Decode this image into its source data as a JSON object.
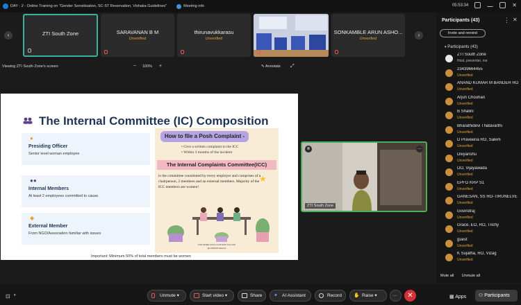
{
  "topbar": {
    "title": "DAY - 2 - Online Training on \"Gender Sensitisation, SC-ST Reservation, Vishaka Guidelines\"",
    "meeting_info": "Meeting info",
    "time": "05:53:34"
  },
  "filmstrip": [
    {
      "name": "ZTI South Zone",
      "status": ""
    },
    {
      "name": "SARAVANAN B M",
      "status": "Unverified"
    },
    {
      "name": "thirunavukkarasu",
      "status": "Unverified"
    },
    {
      "name": "",
      "status": ""
    },
    {
      "name": "SONKAMBLE ARUN ASHO...",
      "status": "Unverified"
    }
  ],
  "share_bar": {
    "viewing": "Viewing ZTI South Zone's screen",
    "zoom_out": "−",
    "zoom": "100%",
    "zoom_in": "+",
    "annotate": "Annotate"
  },
  "slide": {
    "title": "The Internal Committee (IC) Composition",
    "sections": [
      {
        "heading": "Presiding Officer",
        "desc": "Senior level woman employee"
      },
      {
        "heading": "Internal Members",
        "desc": "At least 2 employees committed to cause"
      },
      {
        "heading": "External Member",
        "desc": "From NGO/Association familiar with issues"
      }
    ],
    "poster": {
      "heading1": "How to file a Posh Complaint -",
      "bullet1": "• Give a written complaint to the ICC",
      "bullet2": "• Within 3 months of the incident",
      "heading2": "The Internal Complaints Committee(ICC)",
      "body": "is the committee constituted by every employer and comprises of a chairperson, 2 members and an external members. Majority of the ICC members are women!",
      "footer1": "FOR MORE SUCH CONTENT FOLLOW",
      "footer2": "@LAWWITHLEGAL"
    },
    "note": "Important: Minimum 50% of total members must be women"
  },
  "camera": {
    "label": "ZTI South Zone"
  },
  "participants_panel": {
    "title": "Participants (43)",
    "invite": "Invite and remind",
    "sub": "Participants (43)",
    "items": [
      {
        "name": "ZTI South Zone",
        "status": "Host, presenter, me"
      },
      {
        "name": "23439664455",
        "status": "Unverified"
      },
      {
        "name": "ANAND KUMAR M BANDER RO",
        "status": "Unverified"
      },
      {
        "name": "Arjun Chouhan",
        "status": "Unverified"
      },
      {
        "name": "B Shalini",
        "status": "Unverified"
      },
      {
        "name": "Bharathidevi Thatavarthi",
        "status": "Unverified"
      },
      {
        "name": "D Praveena RO, Salem",
        "status": "Unverified"
      },
      {
        "name": "Divyanshu",
        "status": "Unverified"
      },
      {
        "name": "DO, Vijayawada",
        "status": "Unverified"
      },
      {
        "name": "EPFO KRP S1",
        "status": "Unverified"
      },
      {
        "name": "GANESAN, SS   RO-TIRUNELVE",
        "status": "Unverified"
      },
      {
        "name": "Govindraj",
        "status": "Unverified"
      },
      {
        "name": "Grace, EO, RO, Trichy",
        "status": "Unverified"
      },
      {
        "name": "guest",
        "status": "Unverified"
      },
      {
        "name": "K Sujatha, RO, Vizag",
        "status": "Unverified"
      }
    ],
    "mute_all": "Mute all",
    "unmute_all": "Unmute all"
  },
  "toolbar": {
    "unmute": "Unmute",
    "start_video": "Start video",
    "share": "Share",
    "ai_assistant": "AI Assistant",
    "record": "Record",
    "raise": "Raise",
    "more": "···",
    "end": "✕",
    "apps": "Apps",
    "participants": "Participants"
  }
}
